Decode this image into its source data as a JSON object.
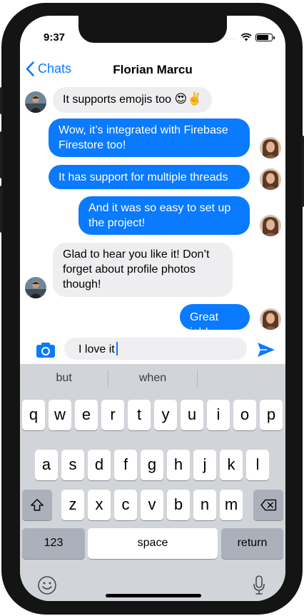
{
  "status_bar": {
    "time": "9:37",
    "signal": "....."
  },
  "nav": {
    "back_label": "Chats",
    "title": "Florian Marcu"
  },
  "messages": [
    {
      "direction": "incoming",
      "text": "It supports emojis too",
      "emoji": "😍✌️"
    },
    {
      "direction": "outgoing",
      "lines": [
        "Wow, it’s integrated with Firebase",
        "Firestore too!"
      ]
    },
    {
      "direction": "outgoing",
      "lines": [
        "It has support for multiple threads"
      ]
    },
    {
      "direction": "outgoing",
      "lines": [
        "And it was so easy to set up",
        "the project!"
      ]
    },
    {
      "direction": "incoming",
      "lines": [
        "Glad to hear you like it! Don’t",
        "forget about profile photos",
        "though!"
      ]
    },
    {
      "direction": "outgoing",
      "lines": [
        "Great job!"
      ]
    }
  ],
  "composer": {
    "value": "I love it"
  },
  "keyboard": {
    "suggestions": [
      "but",
      "when",
      ""
    ],
    "row1": [
      "q",
      "w",
      "e",
      "r",
      "t",
      "y",
      "u",
      "i",
      "o",
      "p"
    ],
    "row2": [
      "a",
      "s",
      "d",
      "f",
      "g",
      "h",
      "j",
      "k",
      "l"
    ],
    "row3": [
      "z",
      "x",
      "c",
      "v",
      "b",
      "n",
      "m"
    ],
    "numbers_label": "123",
    "space_label": "space",
    "return_label": "return"
  },
  "colors": {
    "accent": "#0a7aff",
    "incoming_bubble": "#eeeef0",
    "keyboard_bg": "#d1d4d9"
  },
  "icons": [
    "chevron-left-icon",
    "camera-icon",
    "send-icon",
    "shift-icon",
    "delete-icon",
    "emoji-icon",
    "mic-icon",
    "wifi-icon",
    "battery-icon"
  ]
}
